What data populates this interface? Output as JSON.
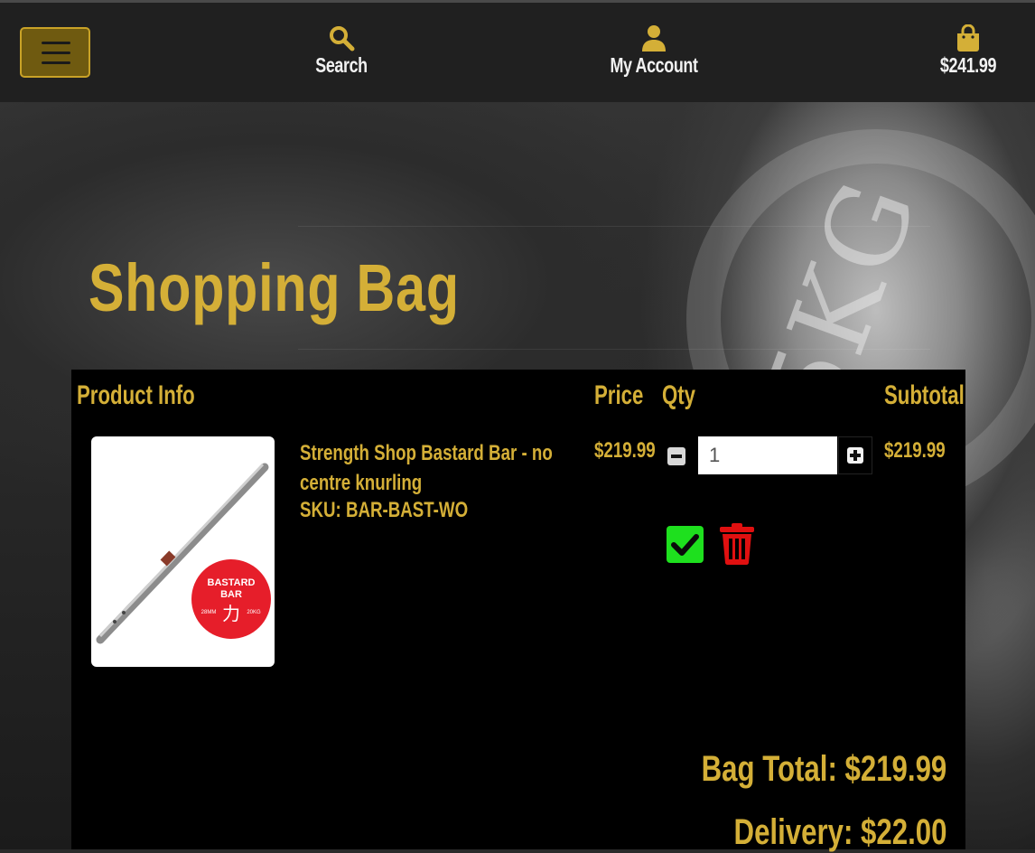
{
  "header": {
    "menu_icon": "hamburger-menu-icon",
    "search": {
      "label": "Search",
      "icon": "search-icon"
    },
    "account": {
      "label": "My Account",
      "icon": "user-icon"
    },
    "bag": {
      "total": "$241.99",
      "icon": "shopping-bag-icon"
    }
  },
  "page": {
    "title": "Shopping Bag"
  },
  "table": {
    "headers": {
      "product_info": "Product Info",
      "price": "Price",
      "qty": "Qty",
      "subtotal": "Subtotal"
    },
    "items": [
      {
        "name": "Strength Shop Bastard Bar - no centre knurling",
        "sku": "SKU: BAR-BAST-WO",
        "price": "$219.99",
        "quantity": "1",
        "subtotal": "$219.99",
        "image_badge": {
          "line1": "BASTARD",
          "line2": "BAR",
          "glyph": "力",
          "left": "28MM",
          "right": "20KG"
        }
      }
    ]
  },
  "totals": {
    "bag_total": "Bag Total: $219.99",
    "delivery": "Delivery: $22.00"
  },
  "colors": {
    "accent": "#d4af37",
    "header_bg": "#202020",
    "update_green": "#1ee01e",
    "remove_red": "#e01010"
  }
}
